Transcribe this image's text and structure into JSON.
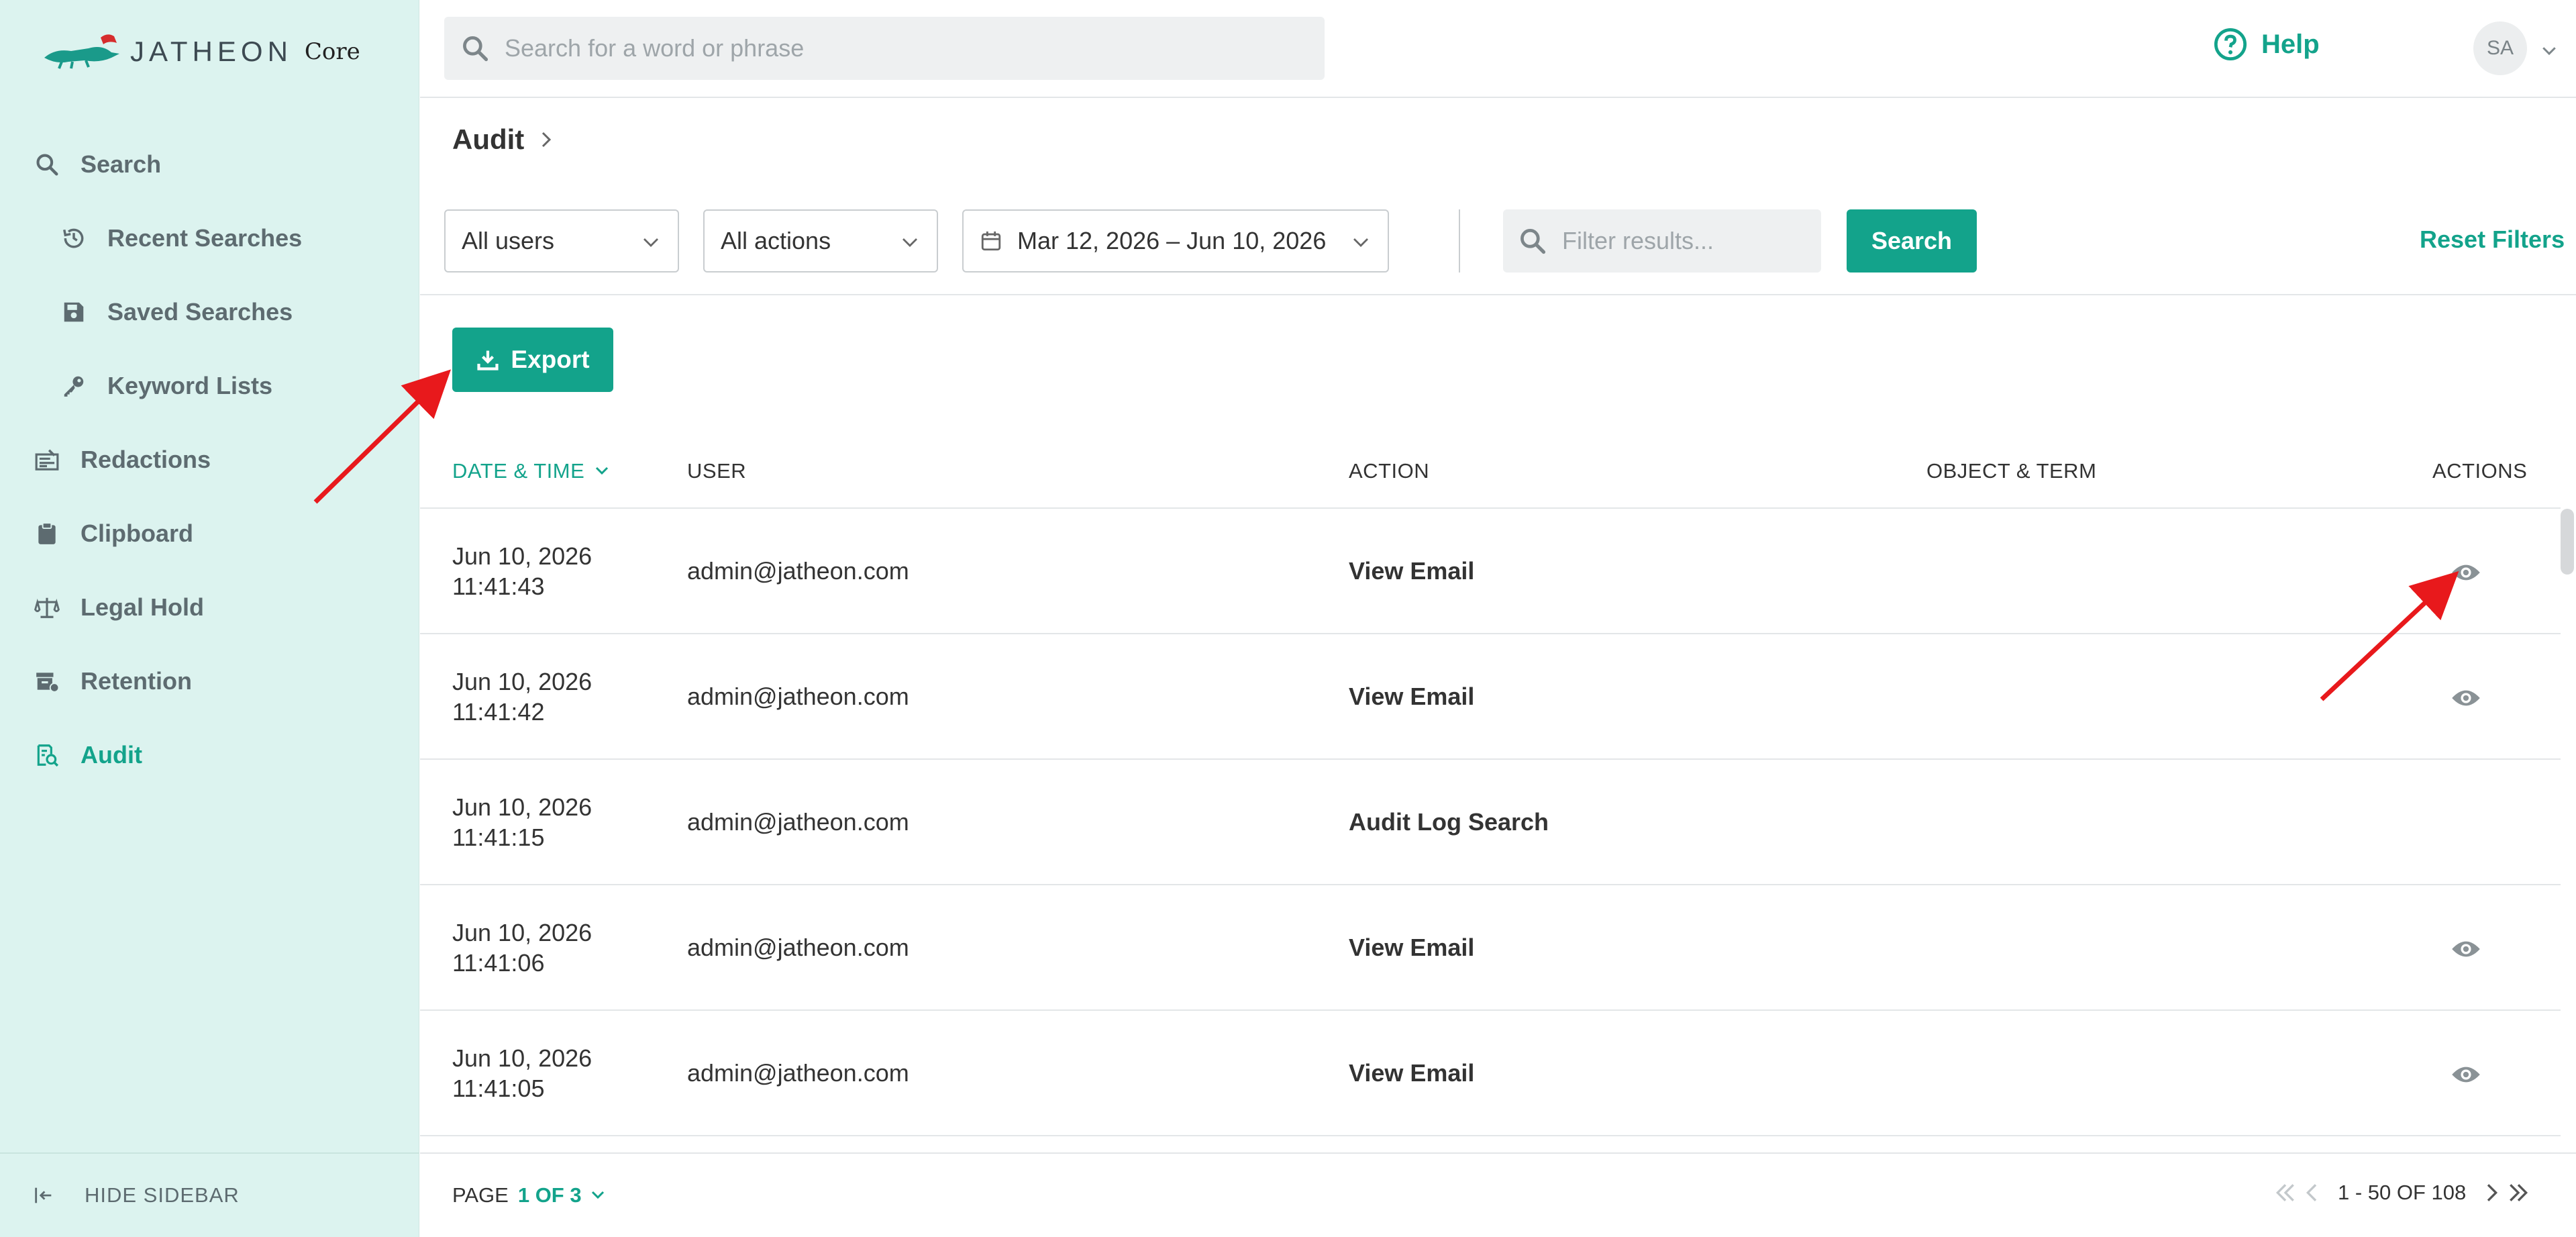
{
  "app": {
    "logo_text": "JATHEON",
    "logo_product": "Core"
  },
  "sidebar": {
    "items": [
      {
        "label": "Search",
        "icon": "search-icon",
        "level": 1,
        "active": false
      },
      {
        "label": "Recent Searches",
        "icon": "history-icon",
        "level": 2,
        "active": false
      },
      {
        "label": "Saved Searches",
        "icon": "save-icon",
        "level": 2,
        "active": false
      },
      {
        "label": "Keyword Lists",
        "icon": "key-icon",
        "level": 2,
        "active": false
      },
      {
        "label": "Redactions",
        "icon": "redaction-icon",
        "level": 1,
        "active": false
      },
      {
        "label": "Clipboard",
        "icon": "clipboard-icon",
        "level": 1,
        "active": false
      },
      {
        "label": "Legal Hold",
        "icon": "scale-icon",
        "level": 1,
        "active": false
      },
      {
        "label": "Retention",
        "icon": "retention-icon",
        "level": 1,
        "active": false
      },
      {
        "label": "Audit",
        "icon": "audit-icon",
        "level": 1,
        "active": true
      }
    ],
    "hide_label": "HIDE SIDEBAR"
  },
  "topbar": {
    "search_placeholder": "Search for a word or phrase",
    "help_label": "Help",
    "avatar_initials": "SA"
  },
  "page": {
    "title": "Audit"
  },
  "filters": {
    "users_value": "All users",
    "actions_value": "All actions",
    "date_range_value": "Mar 12, 2026 – Jun 10, 2026",
    "filter_placeholder": "Filter results...",
    "search_button": "Search",
    "reset_label": "Reset Filters"
  },
  "export_label": "Export",
  "table": {
    "columns": [
      "DATE & TIME",
      "USER",
      "ACTION",
      "OBJECT & TERM",
      "ACTIONS"
    ],
    "rows": [
      {
        "date": "Jun 10, 2026",
        "time": "11:41:43",
        "user": "admin@jatheon.com",
        "action": "View Email",
        "object": "",
        "has_view": true
      },
      {
        "date": "Jun 10, 2026",
        "time": "11:41:42",
        "user": "admin@jatheon.com",
        "action": "View Email",
        "object": "",
        "has_view": true
      },
      {
        "date": "Jun 10, 2026",
        "time": "11:41:15",
        "user": "admin@jatheon.com",
        "action": "Audit Log Search",
        "object": "",
        "has_view": false
      },
      {
        "date": "Jun 10, 2026",
        "time": "11:41:06",
        "user": "admin@jatheon.com",
        "action": "View Email",
        "object": "",
        "has_view": true
      },
      {
        "date": "Jun 10, 2026",
        "time": "11:41:05",
        "user": "admin@jatheon.com",
        "action": "View Email",
        "object": "",
        "has_view": true
      }
    ]
  },
  "footer": {
    "page_label": "PAGE",
    "page_value": "1 OF 3",
    "range": "1 - 50 OF 108"
  },
  "colors": {
    "accent": "#13a38b",
    "sidebar_bg": "#dcf3ef",
    "annotation": "#e8191c"
  }
}
